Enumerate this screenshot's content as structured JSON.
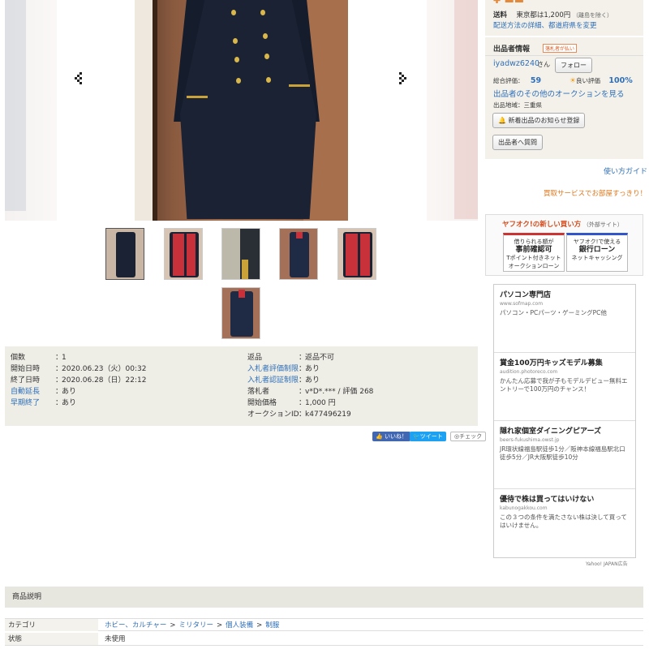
{
  "price": {
    "shipping_label": "送料",
    "shipping_value": "東京都は1,200円",
    "shipping_note": "（離島を除く）",
    "shipping_link": "配送方法の詳細、都道府県を変更"
  },
  "seller": {
    "title": "出品者情報",
    "badge": "落札者が払い",
    "name": "iyadwz6240",
    "honorific": "さん",
    "follow_label": "フォロー",
    "rating_label": "総合評価：",
    "rating_value": "59",
    "good_label": "良い評価",
    "good_percent": "100%",
    "other_auctions": "出品者のその他のオークションを見る",
    "region": "出品地域：三重県",
    "notify_label": "新着出品のお知らせ登録",
    "question_label": "出品者へ質問"
  },
  "right_links": {
    "how_to_use": "使い方ガイド",
    "buyback": "買取サービスでお部屋すっきり！"
  },
  "new_buy": {
    "title": "ヤフオク!の新しい買い方",
    "note": "（外部サイト）",
    "promo1_top": "借りられる額が",
    "promo1_big": "事前確認可",
    "promo1_sub1": "Tポイント付きネット",
    "promo1_sub2": "オークションローン",
    "promo2_top": "ヤフオク!で使える",
    "promo2_big": "銀行ローン",
    "promo2_sub1": "ネットキャッシング"
  },
  "ads": [
    {
      "title": "パソコン専門店",
      "domain": "www.sofmap.com",
      "desc": "パソコン・PCパーツ・ゲーミングPC他"
    },
    {
      "title": "賞金100万円キッズモデル募集",
      "domain": "audition.photoreco.com",
      "desc": "かんたん応募で我が子もモデルデビュー無料エントリーで100万円のチャンス！"
    },
    {
      "title": "隠れ家個室ダイニングピアーズ",
      "domain": "beers-fukushima.owst.jp",
      "desc": "JR環状線福島駅徒歩1分／阪神本線福島駅北口徒歩5分／JR大阪駅徒歩10分"
    },
    {
      "title": "優待で株は買ってはいけない",
      "domain": "kabunogakkou.com",
      "desc": "この３つの条件を満たさない株は決して買ってはいけません。"
    }
  ],
  "ad_footer": "Yahoo! JAPAN広告",
  "info_left": [
    {
      "label": "個数",
      "value": "1",
      "link": false
    },
    {
      "label": "開始日時",
      "value": "2020.06.23（火）00:32",
      "link": false
    },
    {
      "label": "終了日時",
      "value": "2020.06.28（日）22:12",
      "link": false
    },
    {
      "label": "自動延長",
      "value": "あり",
      "link": true
    },
    {
      "label": "早期終了",
      "value": "あり",
      "link": true
    }
  ],
  "info_right": [
    {
      "label": "返品",
      "value": "返品不可",
      "link": false
    },
    {
      "label": "入札者評価制限",
      "value": "あり",
      "link": true
    },
    {
      "label": "入札者認証制限",
      "value": "あり",
      "link": true
    },
    {
      "label": "落札者",
      "value": "v*D*.*** / 評価 268",
      "link": false
    },
    {
      "label": "開始価格",
      "value": "1,000 円",
      "link": false
    },
    {
      "label": "オークションID",
      "value": "k477496219",
      "link": false
    }
  ],
  "social": {
    "like": "いいね！",
    "tweet": "ツイート",
    "check": "チェック"
  },
  "description": {
    "header": "商品説明",
    "category_label": "カテゴリ",
    "category_path": [
      "ホビー、カルチャー",
      "ミリタリー",
      "個人装備",
      "制服"
    ],
    "category_sep": ">",
    "condition_label": "状態",
    "condition_value": "未使用"
  },
  "colors": {
    "link": "#2f6fb8",
    "accent_orange": "#e0781d",
    "panel_bg": "#f3f1ea",
    "info_bg": "#eeede6"
  }
}
